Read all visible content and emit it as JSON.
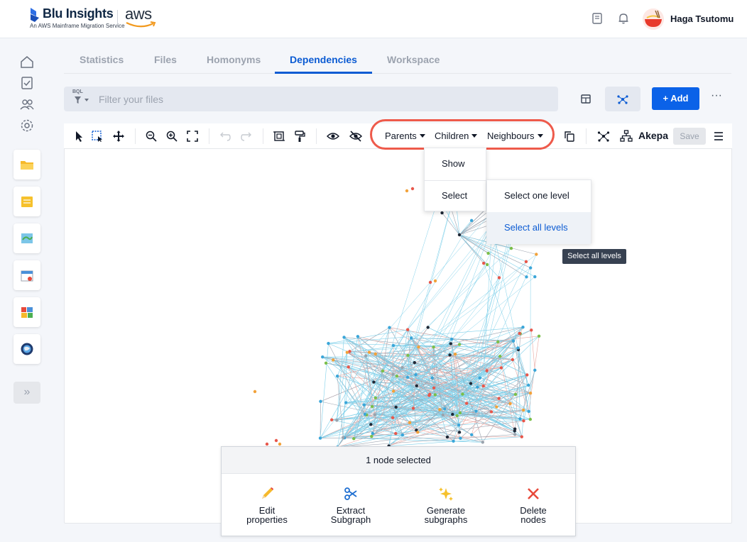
{
  "header": {
    "brand_name": "Blu Insights",
    "brand_subtitle": "An AWS Mainframe Migration Service",
    "partner_logo": "aws",
    "user_name": "Haga Tsutomu",
    "icons": [
      "book-icon",
      "bell-icon",
      "avatar"
    ]
  },
  "rail": {
    "icons": [
      "home-icon",
      "checklist-icon",
      "users-icon",
      "settings-icon"
    ],
    "tiles": [
      "folder-app",
      "notes-app",
      "map-app",
      "calendar-app",
      "blocks-app",
      "globe-app"
    ],
    "expand_label": "»"
  },
  "tabs": [
    {
      "label": "Statistics",
      "active": false
    },
    {
      "label": "Files",
      "active": false
    },
    {
      "label": "Homonyms",
      "active": false
    },
    {
      "label": "Dependencies",
      "active": true
    },
    {
      "label": "Workspace",
      "active": false
    }
  ],
  "filter": {
    "prefix": "BQL",
    "placeholder": "Filter your files"
  },
  "actions": {
    "add_label": "+ Add",
    "more_label": "···"
  },
  "toolbar": {
    "parents_label": "Parents",
    "children_label": "Children",
    "neighbours_label": "Neighbours",
    "layout_name": "Akepa",
    "save_label": "Save",
    "highlight_color": "#ee5a4b"
  },
  "menu_children": {
    "items": [
      "Show",
      "Select"
    ]
  },
  "menu_select": {
    "items": [
      "Select one level",
      "Select all levels"
    ],
    "hovered": "Select all levels"
  },
  "tooltip": "Select all levels",
  "selection": {
    "title": "1 node selected",
    "actions": [
      {
        "line1": "Edit",
        "line2": "properties"
      },
      {
        "line1": "Extract",
        "line2": "Subgraph"
      },
      {
        "line1": "Generate",
        "line2": "subgraphs"
      },
      {
        "line1": "Delete",
        "line2": "nodes"
      }
    ]
  },
  "colors": {
    "accent": "#0b5bd3",
    "primary_button": "#0b62e8",
    "edge_blue": "#7fd0ea",
    "edge_grey": "#9ca3af",
    "edge_red": "#e8a6a0"
  }
}
